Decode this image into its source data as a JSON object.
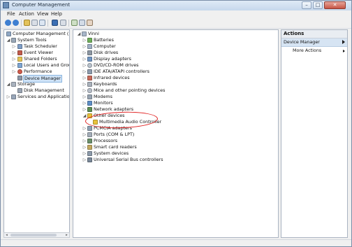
{
  "window": {
    "title": "Computer Management",
    "controls": {
      "minimize": "–",
      "maximize": "□",
      "close": "✕"
    }
  },
  "menu": [
    "File",
    "Action",
    "View",
    "Help"
  ],
  "left_tree": {
    "root": "Computer Management (Local",
    "system_tools": "System Tools",
    "items": [
      "Task Scheduler",
      "Event Viewer",
      "Shared Folders",
      "Local Users and Groups",
      "Performance",
      "Device Manager"
    ],
    "storage": "Storage",
    "disk_management": "Disk Management",
    "services": "Services and Applications"
  },
  "device_tree": {
    "computer_name": "Vinni",
    "categories": [
      "Batteries",
      "Computer",
      "Disk drives",
      "Display adapters",
      "DVD/CD-ROM drives",
      "IDE ATA/ATAPI controllers",
      "Infrared devices",
      "Keyboards",
      "Mice and other pointing devices",
      "Modems",
      "Monitors",
      "Network adapters",
      "Other devices"
    ],
    "other_devices_child": "Multimedia Audio Controller",
    "categories_after": [
      "PCMCIA adapters",
      "Ports (COM & LPT)",
      "Processors",
      "Smart card readers",
      "System devices",
      "Universal Serial Bus controllers"
    ]
  },
  "actions": {
    "header": "Actions",
    "section": "Device Manager",
    "more": "More Actions"
  },
  "scrollbar": {
    "left_arrow": "◂",
    "right_arrow": "▸"
  },
  "colors": {
    "selection": "#cfe3f7",
    "annotation": "#e02020",
    "warning": "#e8c23a"
  }
}
